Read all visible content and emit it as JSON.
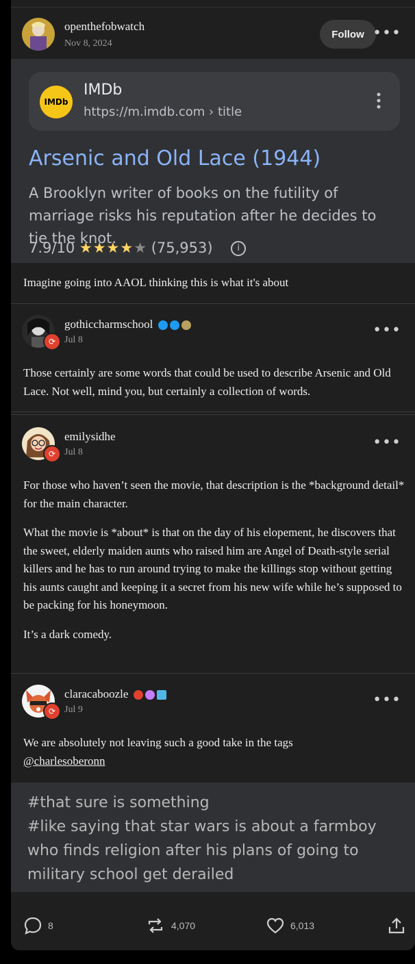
{
  "post": {
    "author": "openthefobwatch",
    "date": "Nov 8, 2024",
    "follow_label": "Follow",
    "more_label": "•••",
    "screenshot": {
      "logo_text": "IMDb",
      "site_name": "IMDb",
      "url": "https://m.imdb.com › title",
      "title": "Arsenic and Old Lace (1944)",
      "snippet": "A Brooklyn writer of books on the futility of marriage risks his reputation after he decides to tie the knot.",
      "rating": "7.9/10",
      "stars": "★★★★",
      "star_empty": "★",
      "votes": "(75,953)",
      "info_icon": "i"
    },
    "caption": "Imagine going into AAOL thinking this is what it's about"
  },
  "reblogs": [
    {
      "author": "gothiccharmschool",
      "date": "Jul 8",
      "more_label": "•••",
      "paragraphs": [
        "Those certainly are some words that could be used to describe Arsenic and Old Lace. Not well, mind you, but certainly a collection of words."
      ]
    },
    {
      "author": "emilysidhe",
      "date": "Jul 8",
      "more_label": "•••",
      "paragraphs": [
        "For those who haven’t seen the movie, that description is the *background detail* for the main character.",
        "What the movie is *about* is that on the day of his elopement, he discovers that the sweet, elderly maiden aunts who raised him are Angel of Death-style serial killers and he has to run around trying to make the killings stop without getting his aunts caught and keeping it a secret from his new wife while he’s supposed to be packing for his honeymoon.",
        "It’s a dark comedy."
      ]
    },
    {
      "author": "claracaboozle",
      "date": "Jul 9",
      "more_label": "•••",
      "text": "We are absolutely not leaving such a good take in the tags",
      "mention": "@charlesoberonn"
    }
  ],
  "tags": {
    "line1": "#that sure is something",
    "line2": "#like saying that star wars is about a farmboy who finds religion after his plans of going to military school get derailed"
  },
  "footer": {
    "replies": "8",
    "reblogs": "4,070",
    "likes": "6,013"
  },
  "colors": {
    "background": "#1f1f1f",
    "link_blue": "#8ab4f8",
    "star_gold": "#fdd663",
    "reblog_red": "#e0412f",
    "verified_blue": "#1d9bf0"
  }
}
